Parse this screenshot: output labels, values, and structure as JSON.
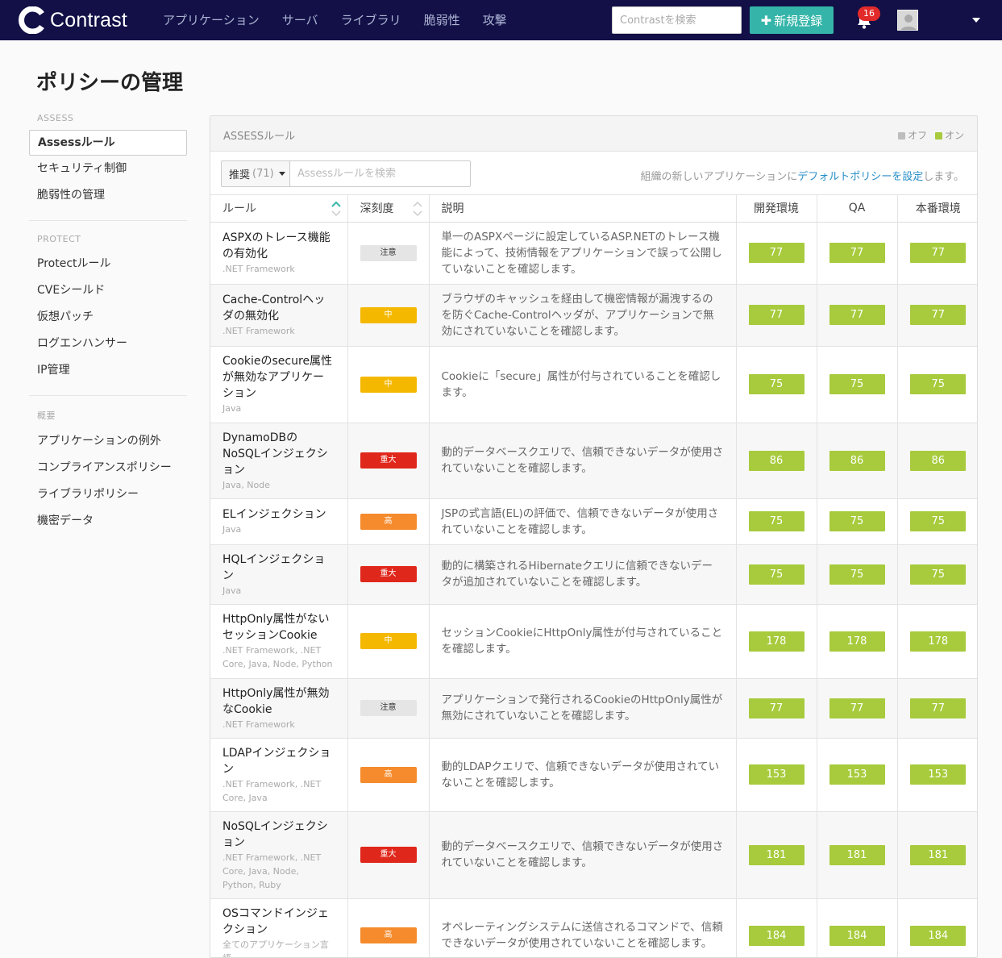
{
  "header": {
    "logo_text": "Contrast",
    "nav": [
      "アプリケーション",
      "サーバ",
      "ライブラリ",
      "脆弱性",
      "攻撃"
    ],
    "search_placeholder": "Contrastを検索",
    "new_button": "新規登録",
    "notification_count": "16"
  },
  "page_title": "ポリシーの管理",
  "sidebar": {
    "sections": [
      {
        "heading": "ASSESS",
        "items": [
          "Assessルール",
          "セキュリティ制御",
          "脆弱性の管理"
        ]
      },
      {
        "heading": "PROTECT",
        "items": [
          "Protectルール",
          "CVEシールド",
          "仮想パッチ",
          "ログエンハンサー",
          "IP管理"
        ]
      },
      {
        "heading": "概要",
        "items": [
          "アプリケーションの例外",
          "コンプライアンスポリシー",
          "ライブラリポリシー",
          "機密データ"
        ]
      }
    ],
    "active_item": "Assessルール"
  },
  "panel": {
    "title": "ASSESSルール",
    "legend_off": "オフ",
    "legend_on": "オン",
    "filter_label": "推奨",
    "filter_count": "(71)",
    "search_placeholder": "Assessルールを検索",
    "note_before": "組織の新しいアプリケーションに",
    "note_link": "デフォルトポリシーを設定",
    "note_after": "します。"
  },
  "table": {
    "headers": [
      "ルール",
      "深刻度",
      "説明",
      "開発環境",
      "QA",
      "本番環境"
    ],
    "rows": [
      {
        "name": "ASPXのトレース機能の有効化",
        "lang": ".NET Framework",
        "severity": "注意",
        "sev_class": "note",
        "desc": "単一のASPXページに設定しているASP.NETのトレース機能によって、技術情報をアプリケーションで誤って公開していないことを確認します。",
        "dev": "77",
        "qa": "77",
        "prod": "77"
      },
      {
        "name": "Cache-Controlヘッダの無効化",
        "lang": ".NET Framework",
        "severity": "中",
        "sev_class": "med",
        "desc": "ブラウザのキャッシュを経由して機密情報が漏洩するのを防ぐCache-Controlヘッダが、アプリケーションで無効にされていないことを確認します。",
        "dev": "77",
        "qa": "77",
        "prod": "77"
      },
      {
        "name": "Cookieのsecure属性が無効なアプリケーション",
        "lang": "Java",
        "severity": "中",
        "sev_class": "med",
        "desc": "Cookieに「secure」属性が付与されていることを確認します。",
        "dev": "75",
        "qa": "75",
        "prod": "75"
      },
      {
        "name": "DynamoDBのNoSQLインジェクション",
        "lang": "Java, Node",
        "severity": "重大",
        "sev_class": "crit",
        "desc": "動的データベースクエリで、信頼できないデータが使用されていないことを確認します。",
        "dev": "86",
        "qa": "86",
        "prod": "86"
      },
      {
        "name": "ELインジェクション",
        "lang": "Java",
        "severity": "高",
        "sev_class": "high",
        "desc": "JSPの式言語(EL)の評価で、信頼できないデータが使用されていないことを確認します。",
        "dev": "75",
        "qa": "75",
        "prod": "75"
      },
      {
        "name": "HQLインジェクション",
        "lang": "Java",
        "severity": "重大",
        "sev_class": "crit",
        "desc": "動的に構築されるHibernateクエリに信頼できないデータが追加されていないことを確認します。",
        "dev": "75",
        "qa": "75",
        "prod": "75"
      },
      {
        "name": "HttpOnly属性がないセッションCookie",
        "lang": ".NET Framework, .NET Core, Java, Node, Python",
        "severity": "中",
        "sev_class": "med",
        "desc": "セッションCookieにHttpOnly属性が付与されていることを確認します。",
        "dev": "178",
        "qa": "178",
        "prod": "178"
      },
      {
        "name": "HttpOnly属性が無効なCookie",
        "lang": ".NET Framework",
        "severity": "注意",
        "sev_class": "note",
        "desc": "アプリケーションで発行されるCookieのHttpOnly属性が無効にされていないことを確認します。",
        "dev": "77",
        "qa": "77",
        "prod": "77"
      },
      {
        "name": "LDAPインジェクション",
        "lang": ".NET Framework, .NET Core, Java",
        "severity": "高",
        "sev_class": "high",
        "desc": "動的LDAPクエリで、信頼できないデータが使用されていないことを確認します。",
        "dev": "153",
        "qa": "153",
        "prod": "153"
      },
      {
        "name": "NoSQLインジェクション",
        "lang": ".NET Framework, .NET Core, Java, Node, Python, Ruby",
        "severity": "重大",
        "sev_class": "crit",
        "desc": "動的データベースクエリで、信頼できないデータが使用されていないことを確認します。",
        "dev": "181",
        "qa": "181",
        "prod": "181"
      },
      {
        "name": "OSコマンドインジェクション",
        "lang": "全てのアプリケーション言語",
        "severity": "高",
        "sev_class": "high",
        "desc": "オペレーティングシステムに送信されるコマンドで、信頼できないデータが使用されていないことを確認します。",
        "dev": "184",
        "qa": "184",
        "prod": "184"
      }
    ]
  },
  "colors": {
    "brand": "#121047",
    "accent": "#35b5a9",
    "on": "#a7cb3c",
    "off": "#bdbdbd",
    "link": "#2b8fc7"
  },
  "icons": [
    "contrast-logo-icon",
    "plus-icon",
    "bell-icon",
    "avatar-icon",
    "chevron-down-icon",
    "sort-icon"
  ]
}
